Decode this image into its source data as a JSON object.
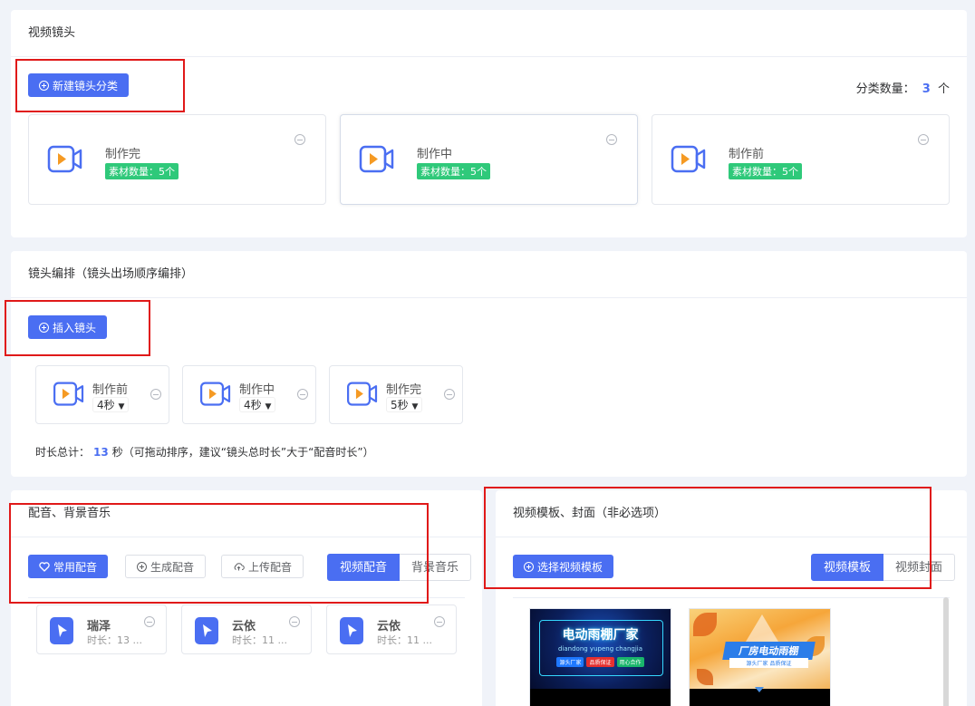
{
  "video_shots": {
    "title": "视频镜头",
    "new_category_label": "新建镜头分类",
    "count_prefix": "分类数量：",
    "count_value": "3",
    "count_suffix": "个",
    "categories": [
      {
        "name": "制作完",
        "badge": "素材数量：5个"
      },
      {
        "name": "制作中",
        "badge": "素材数量：5个"
      },
      {
        "name": "制作前",
        "badge": "素材数量：5个"
      }
    ]
  },
  "arrangement": {
    "title": "镜头编排（镜头出场顺序编排）",
    "insert_label": "插入镜头",
    "shots": [
      {
        "name": "制作前",
        "duration": "4秒"
      },
      {
        "name": "制作中",
        "duration": "4秒"
      },
      {
        "name": "制作完",
        "duration": "5秒"
      }
    ],
    "total_prefix": "时长总计：",
    "total_value": "13",
    "total_suffix": "秒（可拖动排序，建议“镜头总时长”大于“配音时长”）"
  },
  "audio": {
    "title": "配音、背景音乐",
    "common_label": "常用配音",
    "generate_label": "生成配音",
    "upload_label": "上传配音",
    "tabs": [
      "视频配音",
      "背景音乐"
    ],
    "voices": [
      {
        "name": "瑞泽",
        "duration": "时长：13 ..."
      },
      {
        "name": "云依",
        "duration": "时长：11 ..."
      },
      {
        "name": "云依",
        "duration": "时长：11 ..."
      }
    ]
  },
  "template": {
    "title": "视频模板、封面（非必选项）",
    "select_label": "选择视频模板",
    "tabs": [
      "视频模板",
      "视频封面"
    ],
    "cards": [
      {
        "title": "电动雨棚厂家",
        "pinyin": "diandong yupeng changjia",
        "tags": [
          "源头厂家",
          "品质保证",
          "用心合作"
        ]
      },
      {
        "title": "厂房电动雨棚",
        "subtitle": "源头厂家  品质保证"
      }
    ]
  },
  "colors": {
    "primary": "#4a6ef2",
    "badge": "#2fc97a",
    "camera_orange": "#f59a23",
    "highlight": "#e01919"
  }
}
